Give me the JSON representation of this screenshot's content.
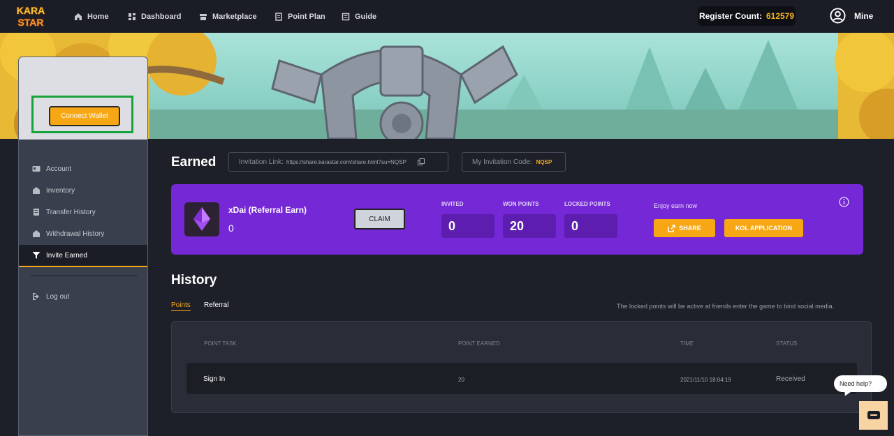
{
  "nav": {
    "logo_text": "KARA STAR",
    "items": [
      {
        "label": "Home",
        "icon": "home-icon"
      },
      {
        "label": "Dashboard",
        "icon": "dashboard-icon"
      },
      {
        "label": "Marketplace",
        "icon": "marketplace-icon"
      },
      {
        "label": "Point Plan",
        "icon": "point-plan-icon"
      },
      {
        "label": "Guide",
        "icon": "guide-icon"
      }
    ],
    "register_label": "Register Count:",
    "register_count": "612579",
    "user_label": "Mine"
  },
  "sidebar": {
    "connect_wallet": "Connect Wallet",
    "items": [
      {
        "label": "Account",
        "icon": "account-icon"
      },
      {
        "label": "Inventory",
        "icon": "inventory-icon"
      },
      {
        "label": "Transfer History",
        "icon": "transfer-history-icon"
      },
      {
        "label": "Withdrawal History",
        "icon": "withdrawal-history-icon"
      },
      {
        "label": "Invite Earned",
        "icon": "invite-earned-icon",
        "active": true
      }
    ],
    "logout": "Log out"
  },
  "earned": {
    "title": "Earned",
    "invitation_link_label": "Invitation Link:",
    "invitation_link": "https://share.karastar.com/share.html?su=NQSP",
    "invitation_code_label": "My Invitation Code:",
    "invitation_code": "NQSP"
  },
  "card": {
    "title": "xDai (Referral Earn)",
    "value": "0",
    "claim": "CLAIM",
    "stats": [
      {
        "label": "INVITED",
        "value": "0"
      },
      {
        "label": "WON POINTS",
        "value": "20"
      },
      {
        "label": "LOCKED POINTS",
        "value": "0"
      }
    ],
    "enjoy": "Enjoy earn now",
    "share": "SHARE",
    "kol": "KOL APPLICATION",
    "accent": "#7528d6"
  },
  "history": {
    "title": "History",
    "tabs": [
      "Points",
      "Referral"
    ],
    "note": "The locked points will be active at friends enter the game to bind social media.",
    "columns": [
      "POINT TASK",
      "POINT EARNED",
      "TIME",
      "STATUS"
    ],
    "rows": [
      {
        "task": "Sign In",
        "earned": "20",
        "time": "2021/11/10 18:04:19",
        "status": "Received"
      }
    ]
  },
  "help": {
    "bubble": "Need help?"
  },
  "colors": {
    "orange": "#f7a714",
    "background": "#1e2029"
  }
}
